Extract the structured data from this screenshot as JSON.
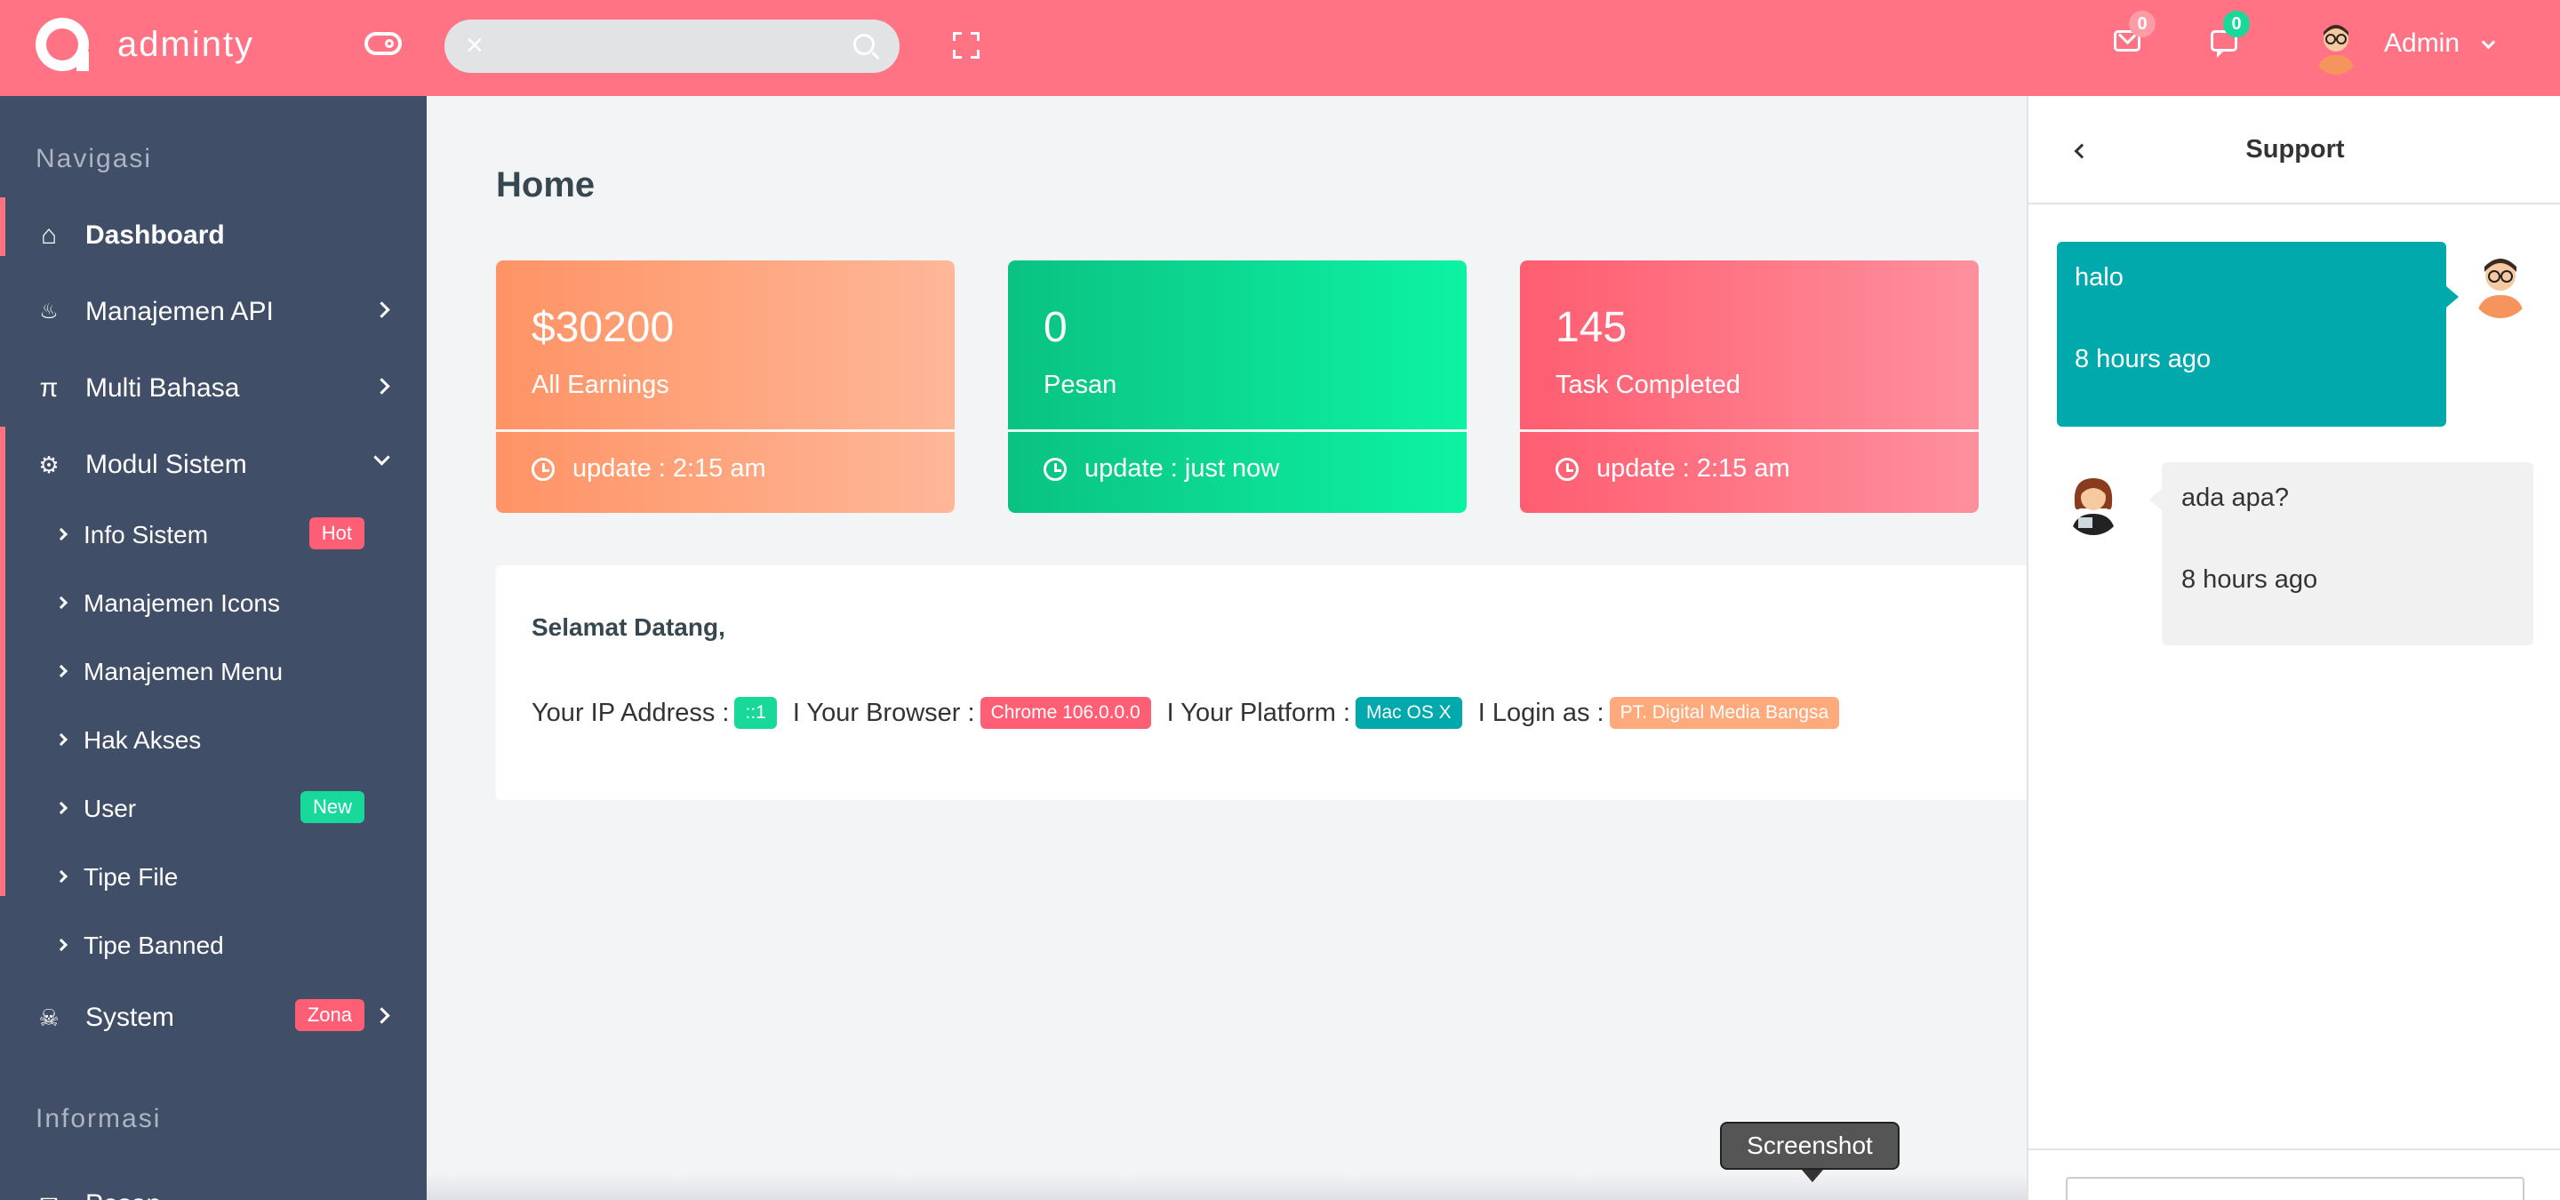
{
  "header": {
    "brand": "adminty",
    "search": {
      "value": "",
      "placeholder": ""
    },
    "mail_count": "0",
    "chat_count": "0",
    "user_name": "Admin"
  },
  "sidebar": {
    "heading_nav": "Navigasi",
    "items": [
      {
        "label": "Dashboard",
        "icon": "home-icon"
      },
      {
        "label": "Manajemen API",
        "icon": "flame-icon"
      },
      {
        "label": "Multi Bahasa",
        "icon": "pi-icon"
      },
      {
        "label": "Modul Sistem",
        "icon": "settings-icon"
      }
    ],
    "sub_items": [
      {
        "label": "Info Sistem",
        "badge": "Hot"
      },
      {
        "label": "Manajemen Icons"
      },
      {
        "label": "Manajemen Menu"
      },
      {
        "label": "Hak Akses"
      },
      {
        "label": "User",
        "badge": "New"
      },
      {
        "label": "Tipe File"
      },
      {
        "label": "Tipe Banned"
      }
    ],
    "system": {
      "label": "System",
      "badge": "Zona",
      "icon": "skull-icon"
    },
    "heading_info": "Informasi",
    "pesan": {
      "label": "Pesan",
      "icon": "mail-icon"
    }
  },
  "main": {
    "title": "Home",
    "cards": [
      {
        "value": "$30200",
        "caption": "All Earnings",
        "update": "update : 2:15 am"
      },
      {
        "value": "0",
        "caption": "Pesan",
        "update": "update : just now"
      },
      {
        "value": "145",
        "caption": "Task Completed",
        "update": "update : 2:15 am"
      }
    ],
    "welcome": {
      "title": "Selamat Datang,",
      "ip_label": "Your IP Address :",
      "ip_value": "::1",
      "browser_label": "I Your Browser :",
      "browser_value": "Chrome 106.0.0.0",
      "platform_label": "I Your Platform :",
      "platform_value": "Mac OS X",
      "login_label": "I Login as :",
      "login_value": "PT. Digital Media Bangsa"
    }
  },
  "support": {
    "title": "Support",
    "messages": [
      {
        "text": "halo",
        "time": "8 hours ago",
        "direction": "outgoing"
      },
      {
        "text": "ada apa?",
        "time": "8 hours ago",
        "direction": "incoming"
      }
    ]
  },
  "tooltip": "Screenshot",
  "colors": {
    "header": "#ff7385",
    "sidebar": "#404e67",
    "accent_teal": "#01a9ac",
    "accent_green": "#18d89a",
    "accent_red": "#ff5f75",
    "accent_orange": "#fe9365"
  }
}
